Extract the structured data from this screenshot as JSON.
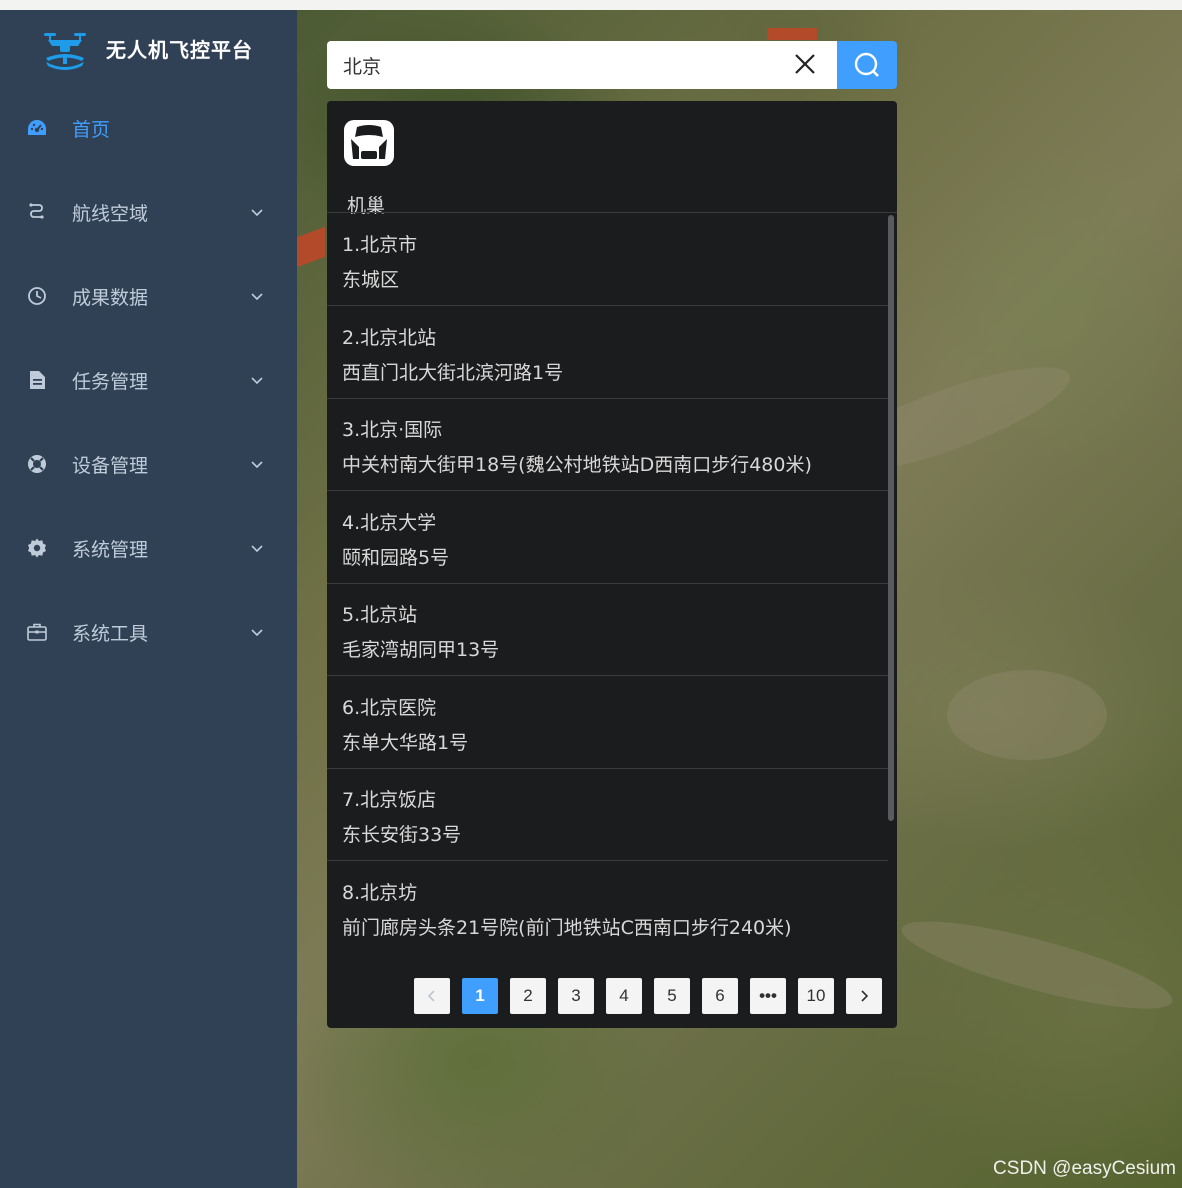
{
  "app": {
    "title": "无人机飞控平台"
  },
  "sidebar": {
    "items": [
      {
        "label": "首页",
        "icon": "dashboard-icon",
        "active": true
      },
      {
        "label": "航线空域",
        "icon": "route-icon",
        "active": false
      },
      {
        "label": "成果数据",
        "icon": "clock-icon",
        "active": false
      },
      {
        "label": "任务管理",
        "icon": "document-icon",
        "active": false
      },
      {
        "label": "设备管理",
        "icon": "lifebuoy-icon",
        "active": false
      },
      {
        "label": "系统管理",
        "icon": "gear-icon",
        "active": false
      },
      {
        "label": "系统工具",
        "icon": "toolbox-icon",
        "active": false
      }
    ]
  },
  "search": {
    "value": "北京",
    "clear_icon": "close-icon",
    "button_icon": "search-icon"
  },
  "results_panel": {
    "category": {
      "label": "机巢",
      "icon": "drone-nest-icon"
    },
    "items": [
      {
        "name": "1.北京市",
        "address": "东城区"
      },
      {
        "name": "2.北京北站",
        "address": "西直门北大街北滨河路1号"
      },
      {
        "name": "3.北京·国际",
        "address": "中关村南大街甲18号(魏公村地铁站D西南口步行480米)"
      },
      {
        "name": "4.北京大学",
        "address": "颐和园路5号"
      },
      {
        "name": "5.北京站",
        "address": "毛家湾胡同甲13号"
      },
      {
        "name": "6.北京医院",
        "address": "东单大华路1号"
      },
      {
        "name": "7.北京饭店",
        "address": "东长安街33号"
      },
      {
        "name": "8.北京坊",
        "address": "前门廊房头条21号院(前门地铁站C西南口步行240米)"
      }
    ],
    "pagination": {
      "pages": [
        "1",
        "2",
        "3",
        "4",
        "5",
        "6",
        "•••",
        "10"
      ],
      "current": "1"
    }
  },
  "watermark": "CSDN @easyCesium",
  "colors": {
    "sidebar_bg": "#304156",
    "accent": "#409eff",
    "panel_bg": "#1b1c1e"
  }
}
